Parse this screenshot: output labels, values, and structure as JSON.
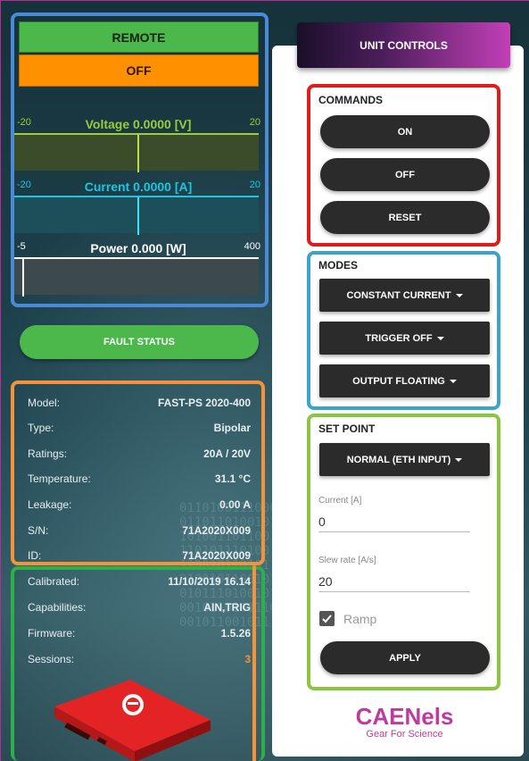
{
  "status": {
    "remote": "REMOTE",
    "output": "OFF"
  },
  "meters": {
    "voltage": {
      "label": "Voltage 0.0000 [V]",
      "min": "-20",
      "max": "20",
      "color": "#9acd3a"
    },
    "current": {
      "label": "Current 0.0000 [A]",
      "min": "-20",
      "max": "20",
      "color": "#1cc6e0"
    },
    "power": {
      "label": "Power 0.000 [W]",
      "min": "-5",
      "max": "400",
      "color": "#ffffff"
    }
  },
  "fault_status": "FAULT STATUS",
  "info": [
    {
      "key": "Model:",
      "value": "FAST-PS 2020-400"
    },
    {
      "key": "Type:",
      "value": "Bipolar"
    },
    {
      "key": "Ratings:",
      "value": "20A / 20V"
    },
    {
      "key": "Temperature:",
      "value": "31.1 °C"
    },
    {
      "key": "Leakage:",
      "value": "0.00 A"
    },
    {
      "key": "S/N:",
      "value": "71A2020X009"
    },
    {
      "key": "ID:",
      "value": "71A2020X009"
    },
    {
      "key": "Calibrated:",
      "value": "11/10/2019 16.14"
    },
    {
      "key": "Capabilities:",
      "value": "AIN,TRIG"
    },
    {
      "key": "Firmware:",
      "value": "1.5.26"
    },
    {
      "key": "Sessions:",
      "value": "3"
    }
  ],
  "unit_controls": {
    "title": "UNIT CONTROLS",
    "commands": {
      "title": "COMMANDS",
      "on": "ON",
      "off": "OFF",
      "reset": "RESET"
    },
    "modes": {
      "title": "MODES",
      "mode": "CONSTANT CURRENT",
      "trigger": "TRIGGER OFF",
      "output": "OUTPUT FLOATING"
    },
    "set_point": {
      "title": "SET POINT",
      "input_mode": "NORMAL (ETH INPUT)",
      "current_label": "Current [A]",
      "current_value": "0",
      "slew_label": "Slew rate [A/s]",
      "slew_value": "20",
      "ramp_label": "Ramp",
      "ramp_checked": true,
      "apply": "APPLY"
    }
  },
  "logo": {
    "name": "CAENels",
    "tagline": "Gear For Science"
  },
  "colors": {
    "remote_green": "#4cb84c",
    "off_orange": "#ff9000",
    "sessions_orange": "#f5923a",
    "brand_magenta": "#c0399e"
  }
}
